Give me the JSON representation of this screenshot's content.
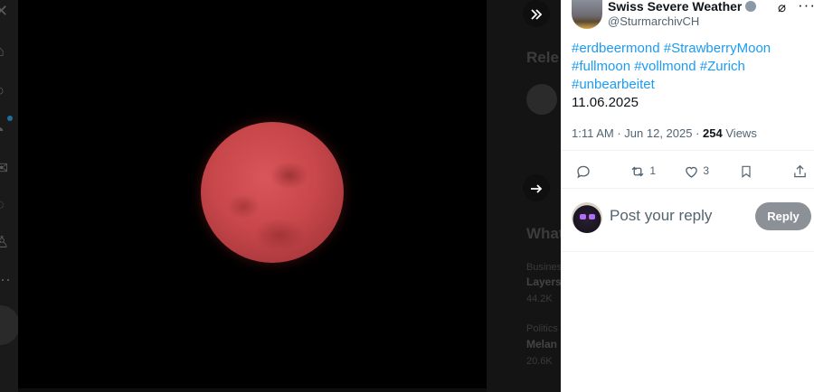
{
  "sidebar_dimmed": {
    "section_heading_1": "Rele",
    "section_heading_2": "What",
    "trend_1_category": "Busines",
    "trend_1_name": "Layers",
    "trend_1_count": "44.2K",
    "trend_2_category": "Politics",
    "trend_2_name": "Melan",
    "trend_2_count": "20.6K"
  },
  "post": {
    "author_name": "Swiss Severe Weather",
    "author_handle": "@SturmarchivCH",
    "hashtag_lines": [
      [
        "#erdbeermond",
        "#StrawberryMoon"
      ],
      [
        "#fullmoon",
        "#vollmond",
        "#Zurich"
      ],
      [
        "#unbearbeitet"
      ]
    ],
    "date_text": "11.06.2025",
    "time": "1:11 AM",
    "date": "Jun 12, 2025",
    "views_count": "254",
    "views_label": "Views",
    "retweet_count": "1",
    "like_count": "3"
  },
  "reply": {
    "placeholder": "Post your reply",
    "button_label": "Reply"
  },
  "icons": {
    "expand": "double-chevron-right-icon",
    "next": "arrow-right-icon",
    "grok": "grok-icon",
    "more": "more-horizontal-icon",
    "reply": "comment-icon",
    "retweet": "retweet-icon",
    "like": "heart-icon",
    "bookmark": "bookmark-icon",
    "share": "share-icon"
  },
  "colors": {
    "link": "#1d9bf0",
    "secondary_text": "#536471",
    "reply_button_bg": "#8c9197"
  }
}
